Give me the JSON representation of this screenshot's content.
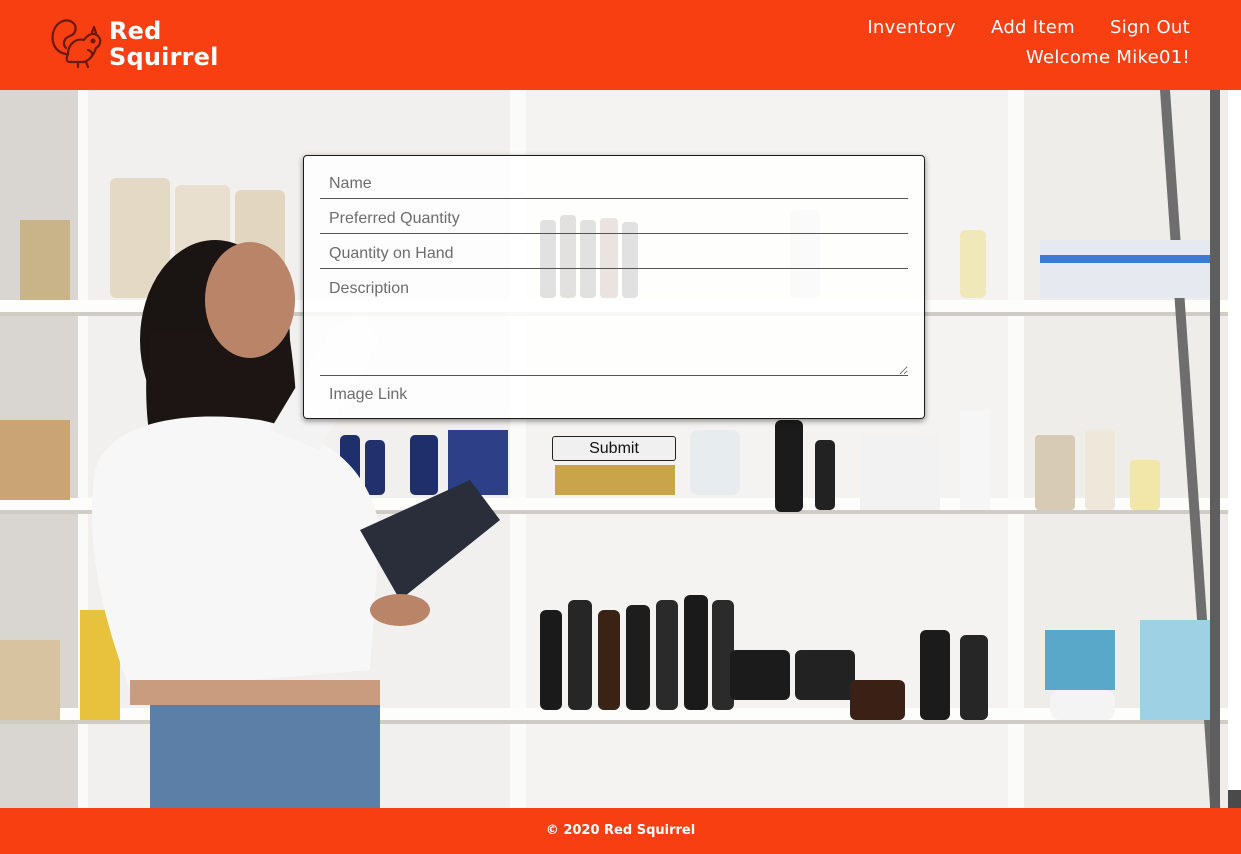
{
  "header": {
    "brand_line1": "Red",
    "brand_line2": "Squirrel",
    "nav": [
      {
        "label": "Inventory"
      },
      {
        "label": "Add Item"
      },
      {
        "label": "Sign Out"
      }
    ],
    "welcome": "Welcome Mike01!"
  },
  "form": {
    "name_placeholder": "Name",
    "preferred_quantity_placeholder": "Preferred Quantity",
    "quantity_on_hand_placeholder": "Quantity on Hand",
    "description_placeholder": "Description",
    "image_link_placeholder": "Image Link",
    "submit_label": "Submit"
  },
  "footer": {
    "text": "© 2020 Red Squirrel"
  },
  "colors": {
    "brand": "#f73f12",
    "header_text": "#ffffff"
  },
  "icons": {
    "logo": "squirrel-icon"
  }
}
